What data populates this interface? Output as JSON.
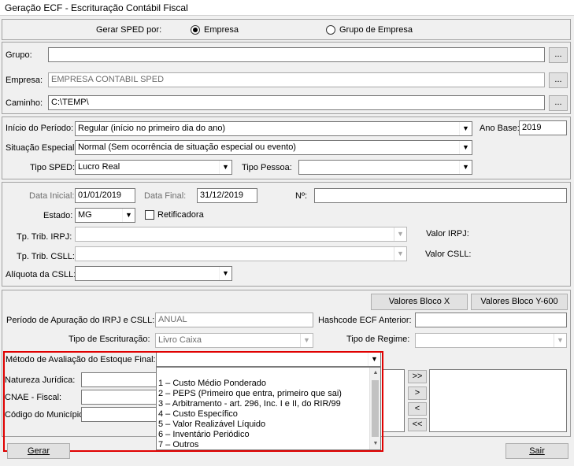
{
  "window": {
    "title": "Geração ECF - Escrituração Contábil Fiscal"
  },
  "sped_mode": {
    "label": "Gerar SPED por:",
    "option_empresa": "Empresa",
    "option_grupo": "Grupo de Empresa",
    "selected": "Empresa"
  },
  "grupo": {
    "label": "Grupo:",
    "value": "",
    "browse": "..."
  },
  "empresa": {
    "label": "Empresa:",
    "value": "EMPRESA CONTABIL SPED",
    "browse": "..."
  },
  "caminho": {
    "label": "Caminho:",
    "value": "C:\\TEMP\\",
    "browse": "..."
  },
  "periodo": {
    "inicio_label": "Início do Período:",
    "inicio_value": "Regular (início no primeiro dia do ano)",
    "ano_base_label": "Ano Base:",
    "ano_base_value": "2019",
    "situacao_label": "Situação Especial:",
    "situacao_value": "Normal (Sem ocorrência de situação especial ou evento)",
    "tipo_sped_label": "Tipo SPED:",
    "tipo_sped_value": "Lucro Real",
    "tipo_pessoa_label": "Tipo Pessoa:",
    "tipo_pessoa_value": ""
  },
  "datas": {
    "inicial_label": "Data Inicial:",
    "inicial_value": "01/01/2019",
    "final_label": "Data Final:",
    "final_value": "31/12/2019",
    "numero_label": "Nº:",
    "numero_value": "",
    "estado_label": "Estado:",
    "estado_value": "MG",
    "retificadora_label": "Retificadora",
    "irpj_label": "Tp. Trib. IRPJ:",
    "irpj_value": "",
    "valor_irpj_label": "Valor IRPJ:",
    "csll_label": "Tp. Trib. CSLL:",
    "csll_value": "",
    "valor_csll_label": "Valor CSLL:",
    "aliquota_label": "Alíquota da CSLL:",
    "aliquota_value": ""
  },
  "bloco": {
    "btn_x": "Valores Bloco X",
    "btn_y600": "Valores Bloco Y-600",
    "periodo_apuracao_label": "Período de Apuração do IRPJ e CSLL:",
    "periodo_apuracao_value": "ANUAL",
    "hashcode_label": "Hashcode ECF Anterior:",
    "hashcode_value": "",
    "tipo_escrituracao_label": "Tipo de Escrituração:",
    "tipo_escrituracao_value": "Livro Caixa",
    "tipo_regime_label": "Tipo de Regime:",
    "tipo_regime_value": ""
  },
  "estoque": {
    "label": "Método de Avaliação do Estoque Final:",
    "value": "",
    "options": [
      "1 – Custo Médio Ponderado",
      "2 – PEPS (Primeiro que entra, primeiro que sai)",
      "3 – Arbitramento - art. 296, Inc. I e II, do RIR/99",
      "4 – Custo Específico",
      "5 – Valor Realizável Líquido",
      "6 – Inventário Periódico",
      "7 – Outros"
    ]
  },
  "extra": {
    "natureza_label": "Natureza Jurídica:",
    "cnae_label": "CNAE - Fiscal:",
    "municipio_label": "Código do Município:",
    "move_all_right": ">>",
    "move_right": ">",
    "move_left": "<",
    "move_all_left": "<<"
  },
  "footer": {
    "gerar": "Gerar",
    "sair": "Sair"
  }
}
